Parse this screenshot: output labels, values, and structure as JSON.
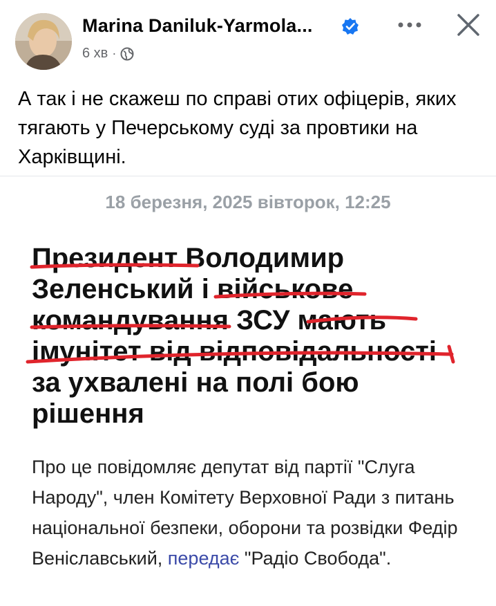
{
  "header": {
    "author_name": "Marina Daniluk-Yarmola...",
    "verified_icon": "verified-badge-icon",
    "time_ago": "6 хв",
    "separator": "·",
    "audience_icon": "globe-icon",
    "more_icon": "more-options-icon",
    "close_icon": "close-icon",
    "accent_color": "#1877f2"
  },
  "post": {
    "text": "А так і не скажеш по справі отих офіцерів, яких тягають у Печерському суді за провтики на Харківщині."
  },
  "attachment": {
    "date_line": "18 березня, 2025 вівторок, 12:25",
    "headline_lines": [
      "Президент Володимир",
      "Зеленський і військове",
      "командування ЗСУ мають",
      "імунітет від відповідальності",
      "за ухвалені на полі бою",
      "рішення"
    ],
    "body_before_link": "Про це повідомляє депутат від партії \"Слуга Народу\", член Комітету Верховної Ради з питань національної безпеки, оборони та розвідки Федір Веніславський, ",
    "body_link": "передає",
    "body_after_link": " \"Радіо Свобода\".",
    "underline_color": "#e0242c"
  }
}
